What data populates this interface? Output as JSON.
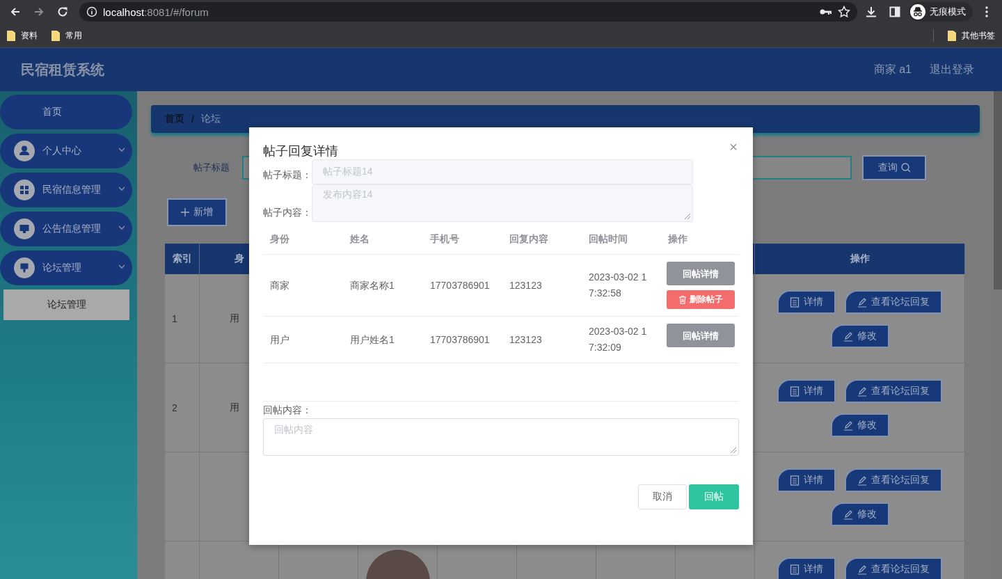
{
  "browser": {
    "url": {
      "host": "localhost",
      "rest": ":8081/#/forum"
    },
    "profile": "无痕模式",
    "bookmarks": [
      {
        "label": "资料"
      },
      {
        "label": "常用"
      }
    ],
    "other_bookmarks": "其他书签"
  },
  "header": {
    "title": "民宿租赁系统",
    "user": "商家 a1",
    "logout": "退出登录"
  },
  "sidebar": {
    "items": [
      {
        "label": "首页",
        "kind": "link",
        "selected": false
      },
      {
        "label": "个人中心",
        "kind": "group",
        "selected": false
      },
      {
        "label": "民宿信息管理",
        "kind": "group",
        "selected": false
      },
      {
        "label": "公告信息管理",
        "kind": "group",
        "selected": false
      },
      {
        "label": "论坛管理",
        "kind": "group",
        "selected": false,
        "children": [
          {
            "label": "论坛管理",
            "selected": true
          }
        ]
      }
    ]
  },
  "content": {
    "breadcrumb": [
      "首页",
      "论坛"
    ],
    "breadcrumb_separator": "/",
    "search": {
      "label": "帖子标题",
      "button": "查询"
    },
    "add_button": "新增",
    "table": {
      "columns": [
        {
          "label": "索引"
        },
        {
          "label": "身"
        },
        {
          "label": "操作"
        }
      ],
      "rows": [
        {
          "index": "1",
          "column_2": "用",
          "actions": [
            {
              "label": "详情",
              "kind": "detail"
            },
            {
              "label": "查看论坛回复",
              "kind": "edit"
            },
            {
              "label": "修改",
              "kind": "edit"
            }
          ]
        },
        {
          "index": "2",
          "column_2": "用",
          "actions": [
            {
              "label": "详情",
              "kind": "detail"
            },
            {
              "label": "查看论坛回复",
              "kind": "edit"
            },
            {
              "label": "修改",
              "kind": "edit"
            }
          ]
        },
        {
          "actions": [
            {
              "label": "详情",
              "kind": "detail"
            },
            {
              "label": "查看论坛回复",
              "kind": "edit"
            },
            {
              "label": "修改",
              "kind": "edit"
            }
          ]
        },
        {
          "column_4": {
            "kind": "photo"
          },
          "actions": [
            {
              "label": "详情",
              "kind": "detail"
            },
            {
              "label": "查看论坛回复",
              "kind": "edit"
            }
          ]
        }
      ]
    }
  },
  "dialog": {
    "title": "帖子回复详情",
    "close": "×",
    "fields": [
      {
        "label": "帖子标题：",
        "value": "帖子标题14",
        "kind": "input",
        "disabled": true
      },
      {
        "label": "帖子内容：",
        "value": "发布内容14",
        "kind": "textarea",
        "disabled": true
      }
    ],
    "table": {
      "columns": [
        "身份",
        "姓名",
        "手机号",
        "回复内容",
        "回帖时间",
        "操作"
      ],
      "rows": [
        {
          "cells": [
            "商家",
            "商家名称1",
            "17703786901",
            "123123",
            "2023-03-02 17:32:58"
          ],
          "actions": [
            {
              "label": "回帖详情",
              "kind": "detail"
            },
            {
              "label": "删除帖子",
              "kind": "delete"
            }
          ]
        },
        {
          "cells": [
            "用户",
            "用户姓名1",
            "17703786901",
            "123123",
            "2023-03-02 17:32:09"
          ],
          "actions": [
            {
              "label": "回帖详情",
              "kind": "detail"
            }
          ]
        }
      ]
    },
    "reply": {
      "label": "回帖内容：",
      "placeholder": "回帖内容"
    },
    "buttons": [
      {
        "label": "取消",
        "kind": "cancel"
      },
      {
        "label": "回帖",
        "kind": "primary"
      }
    ]
  }
}
